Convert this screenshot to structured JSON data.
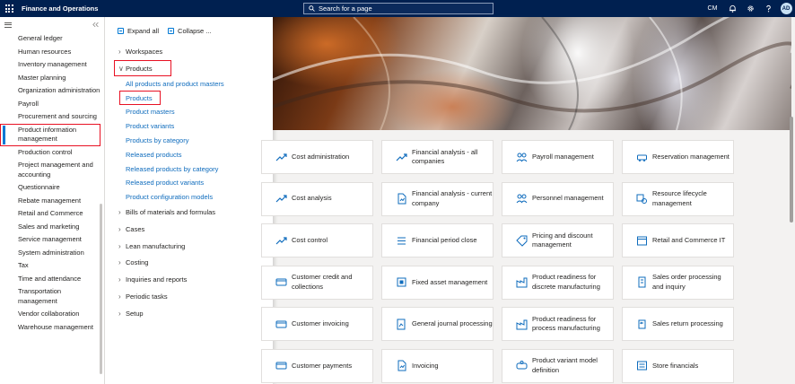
{
  "topbar": {
    "app_title": "Finance and Operations",
    "search_placeholder": "Search for a page",
    "company": "CM",
    "avatar_initials": "AD"
  },
  "leftnav": {
    "items": [
      {
        "label": "General ledger"
      },
      {
        "label": "Human resources"
      },
      {
        "label": "Inventory management"
      },
      {
        "label": "Master planning"
      },
      {
        "label": "Organization administration"
      },
      {
        "label": "Payroll"
      },
      {
        "label": "Procurement and sourcing"
      },
      {
        "label": "Product information management",
        "selected": true
      },
      {
        "label": "Production control"
      },
      {
        "label": "Project management and accounting"
      },
      {
        "label": "Questionnaire"
      },
      {
        "label": "Rebate management"
      },
      {
        "label": "Retail and Commerce"
      },
      {
        "label": "Sales and marketing"
      },
      {
        "label": "Service management"
      },
      {
        "label": "System administration"
      },
      {
        "label": "Tax"
      },
      {
        "label": "Time and attendance"
      },
      {
        "label": "Transportation management"
      },
      {
        "label": "Vendor collaboration"
      },
      {
        "label": "Warehouse management"
      }
    ]
  },
  "flyout": {
    "expand_all": "Expand all",
    "collapse": "Collapse ...",
    "workspaces": "Workspaces",
    "products_group": "Products",
    "product_links": [
      "All products and product masters",
      "Products",
      "Product masters",
      "Product variants",
      "Products by category",
      "Released products",
      "Released products by category",
      "Released product variants",
      "Product configuration models"
    ],
    "other_groups": [
      "Bills of materials and formulas",
      "Cases",
      "Lean manufacturing",
      "Costing",
      "Inquiries and reports",
      "Periodic tasks",
      "Setup"
    ]
  },
  "tiles": [
    {
      "label": "Cost administration",
      "icon": "trend-icon"
    },
    {
      "label": "Financial analysis - all companies",
      "icon": "trend-icon"
    },
    {
      "label": "Payroll management",
      "icon": "people-icon"
    },
    {
      "label": "Reservation management",
      "icon": "vehicle-icon"
    },
    {
      "label": "Cost analysis",
      "icon": "trend-icon"
    },
    {
      "label": "Financial analysis - current company",
      "icon": "document-icon"
    },
    {
      "label": "Personnel management",
      "icon": "people-icon"
    },
    {
      "label": "Resource lifecycle management",
      "icon": "lifecycle-icon"
    },
    {
      "label": "Cost control",
      "icon": "trend-icon"
    },
    {
      "label": "Financial period close",
      "icon": "list-icon"
    },
    {
      "label": "Pricing and discount management",
      "icon": "tag-icon"
    },
    {
      "label": "Retail and Commerce IT",
      "icon": "calendar-icon"
    },
    {
      "label": "Customer credit and collections",
      "icon": "card-icon"
    },
    {
      "label": "Fixed asset management",
      "icon": "asset-icon"
    },
    {
      "label": "Product readiness for discrete manufacturing",
      "icon": "factory-icon"
    },
    {
      "label": "Sales order processing and inquiry",
      "icon": "order-icon"
    },
    {
      "label": "Customer invoicing",
      "icon": "card-icon"
    },
    {
      "label": "General journal processing",
      "icon": "journal-icon"
    },
    {
      "label": "Product readiness for process manufacturing",
      "icon": "factory-icon"
    },
    {
      "label": "Sales return processing",
      "icon": "return-icon"
    },
    {
      "label": "Customer payments",
      "icon": "card-icon"
    },
    {
      "label": "Invoicing",
      "icon": "document-icon"
    },
    {
      "label": "Product variant model definition",
      "icon": "variant-icon"
    },
    {
      "label": "Store financials",
      "icon": "store-icon"
    }
  ],
  "colors": {
    "topbar": "#002050",
    "accent": "#0078d4",
    "link": "#0f6cbd",
    "highlight": "#e81123"
  }
}
